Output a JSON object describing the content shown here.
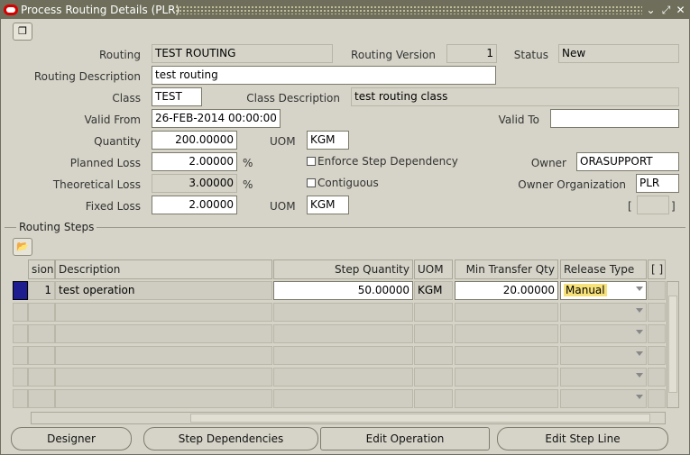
{
  "window": {
    "title": "Process Routing Details (PLR)",
    "controls": [
      "minimize-icon",
      "maximize-icon",
      "close-icon"
    ]
  },
  "header": {
    "routing_label": "Routing",
    "routing_value": "TEST ROUTING",
    "routing_version_label": "Routing Version",
    "routing_version_value": "1",
    "status_label": "Status",
    "status_value": "New",
    "routing_description_label": "Routing Description",
    "routing_description_value": "test routing",
    "class_label": "Class",
    "class_value": "TEST",
    "class_description_label": "Class Description",
    "class_description_value": "test routing class",
    "valid_from_label": "Valid From",
    "valid_from_value": "26-FEB-2014 00:00:00",
    "valid_to_label": "Valid To",
    "valid_to_value": "",
    "quantity_label": "Quantity",
    "quantity_value": "200.00000",
    "uom_label": "UOM",
    "uom_value": "KGM",
    "planned_loss_label": "Planned Loss",
    "planned_loss_value": "2.00000",
    "percent": "%",
    "enforce_step_dependency_label": "Enforce Step Dependency",
    "owner_label": "Owner",
    "owner_value": "ORASUPPORT",
    "theoretical_loss_label": "Theoretical Loss",
    "theoretical_loss_value": "3.00000",
    "contiguous_label": "Contiguous",
    "owner_org_label": "Owner Organization",
    "owner_org_value": "PLR",
    "fixed_loss_label": "Fixed Loss",
    "fixed_loss_value": "2.00000",
    "fixed_uom_label": "UOM",
    "fixed_uom_value": "KGM",
    "bracket_open": "[",
    "bracket_close": "]"
  },
  "routing_steps": {
    "section_title": "Routing Steps",
    "columns": {
      "version": "sion",
      "description": "Description",
      "step_quantity": "Step Quantity",
      "uom": "UOM",
      "min_transfer_qty": "Min Transfer Qty",
      "release_type": "Release Type",
      "folder": "[ ]"
    },
    "rows": [
      {
        "version": "1",
        "description": "test operation",
        "step_quantity": "50.00000",
        "uom": "KGM",
        "min_transfer_qty": "20.00000",
        "release_type": "Manual"
      }
    ]
  },
  "buttons": {
    "designer": "Designer",
    "step_dependencies": "Step Dependencies",
    "edit_operation": "Edit Operation",
    "edit_step_line": "Edit Step Line"
  }
}
